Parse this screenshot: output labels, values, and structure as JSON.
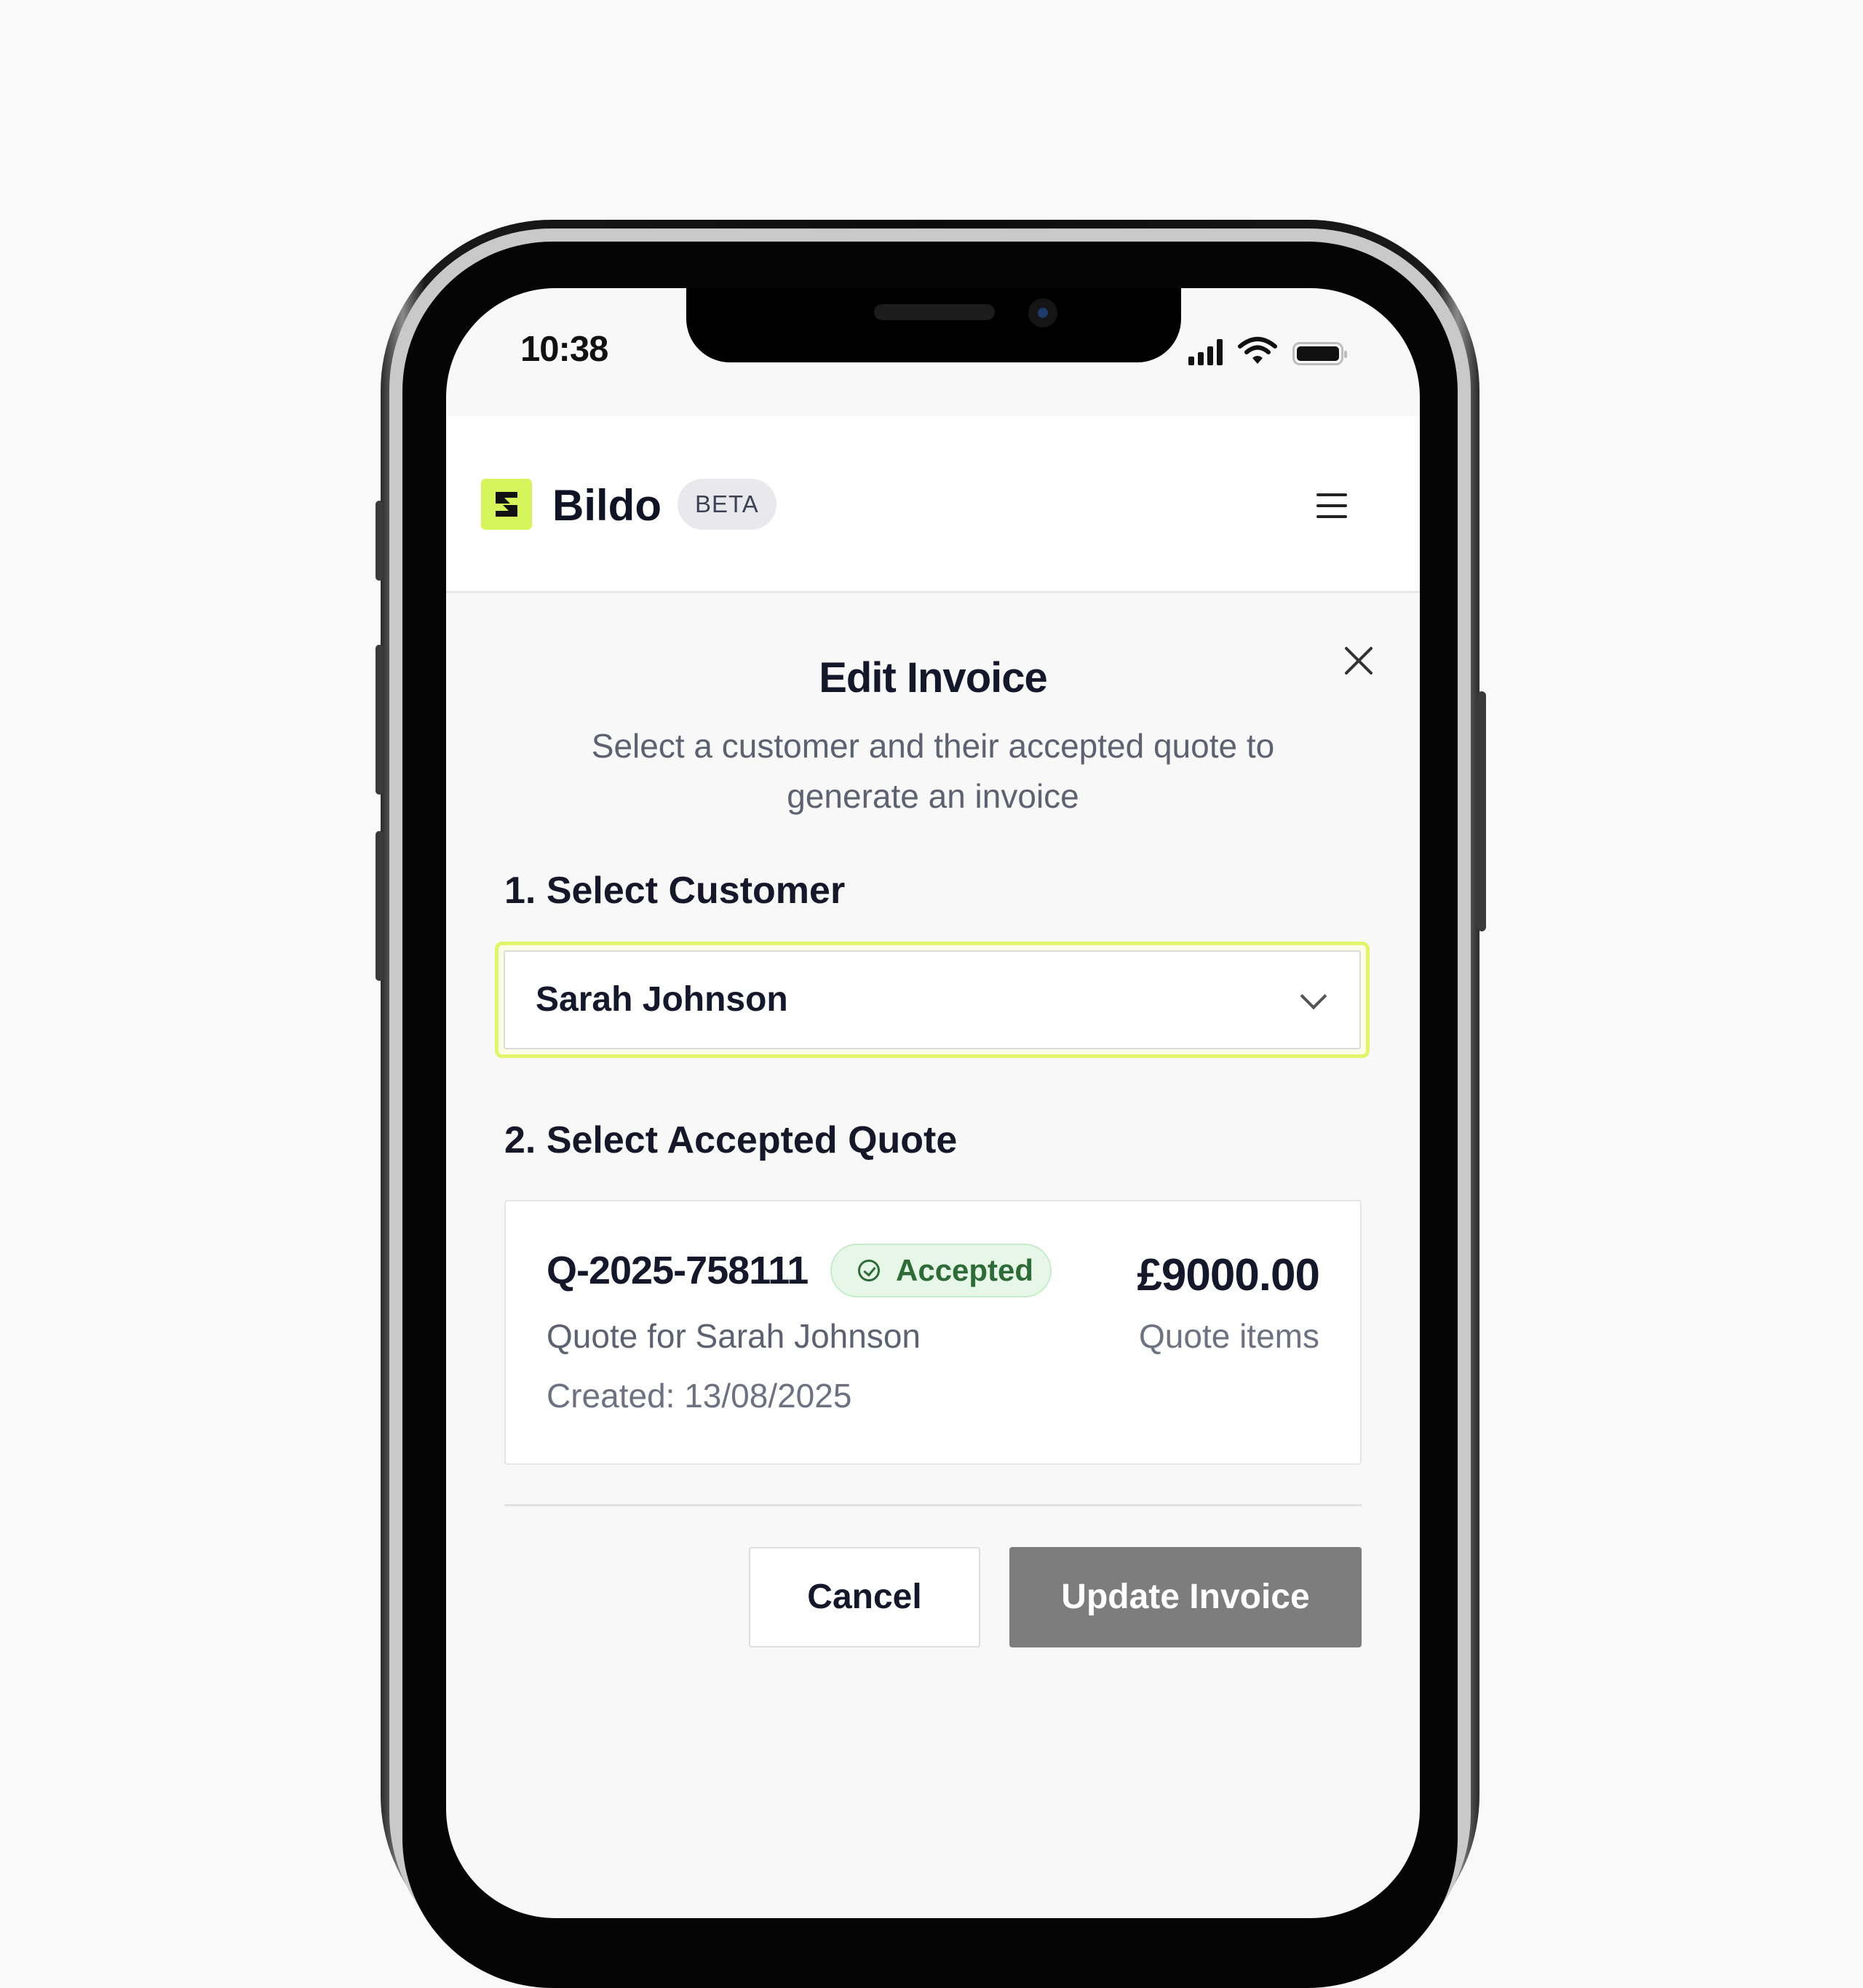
{
  "status_bar": {
    "time": "10:38"
  },
  "header": {
    "brand": "Bildo",
    "badge": "BETA"
  },
  "modal": {
    "title": "Edit Invoice",
    "subtitle": "Select a customer and their accepted quote to generate an invoice",
    "step1_label": "1. Select Customer",
    "customer_selected": "Sarah Johnson",
    "step2_label": "2. Select Accepted Quote",
    "quote": {
      "id": "Q-2025-758111",
      "status": "Accepted",
      "amount": "£9000.00",
      "description": "Quote for Sarah Johnson",
      "items_label": "Quote items",
      "created": "Created: 13/08/2025"
    },
    "cancel_label": "Cancel",
    "submit_label": "Update Invoice"
  },
  "colors": {
    "accent": "#d6f55b",
    "select_focus": "#e2f56a",
    "status_bg": "#e6f7e8",
    "status_text": "#2f6b38",
    "primary_disabled": "#7d7d7d"
  },
  "icons": [
    "signal-icon",
    "wifi-icon",
    "battery-icon",
    "logo-icon",
    "menu-icon",
    "close-icon",
    "chevron-down-icon",
    "check-circle-icon"
  ]
}
